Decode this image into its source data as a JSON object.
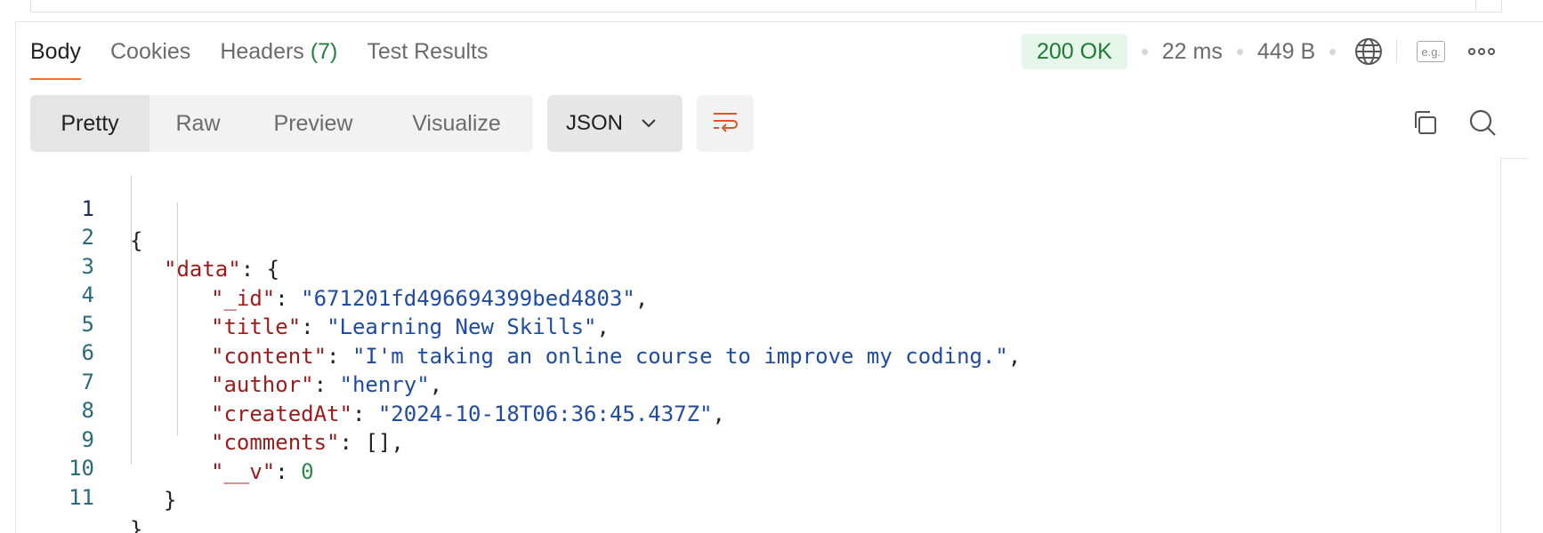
{
  "response_tabs": [
    {
      "label": "Body",
      "active": true
    },
    {
      "label": "Cookies",
      "active": false
    },
    {
      "label": "Headers",
      "count": "(7)",
      "active": false
    },
    {
      "label": "Test Results",
      "active": false
    }
  ],
  "status": {
    "code_text": "200 OK",
    "time": "22 ms",
    "size": "449 B",
    "icons": [
      "globe-icon",
      "example-icon",
      "more-icon"
    ],
    "example_label": "e.g."
  },
  "toolbar": {
    "views": [
      "Pretty",
      "Raw",
      "Preview",
      "Visualize"
    ],
    "active_view": "Pretty",
    "format": "JSON",
    "icons": [
      "chevron-down-icon",
      "wrap-lines-icon",
      "copy-icon",
      "search-icon"
    ]
  },
  "code": {
    "line_numbers": [
      "1",
      "2",
      "3",
      "4",
      "5",
      "6",
      "7",
      "8",
      "9",
      "10",
      "11"
    ],
    "lines": {
      "l1": {
        "punct": "{"
      },
      "l2": {
        "key": "\"data\"",
        "punct": ": {"
      },
      "l3": {
        "key": "\"_id\"",
        "sep": ": ",
        "value": "\"671201fd496694399bed4803\"",
        "end": ","
      },
      "l4": {
        "key": "\"title\"",
        "sep": ": ",
        "value": "\"Learning New Skills\"",
        "end": ","
      },
      "l5": {
        "key": "\"content\"",
        "sep": ": ",
        "value": "\"I'm taking an online course to improve my coding.\"",
        "end": ","
      },
      "l6": {
        "key": "\"author\"",
        "sep": ": ",
        "value": "\"henry\"",
        "end": ","
      },
      "l7": {
        "key": "\"createdAt\"",
        "sep": ": ",
        "value": "\"2024-10-18T06:36:45.437Z\"",
        "end": ","
      },
      "l8": {
        "key": "\"comments\"",
        "sep": ": ",
        "value": "[]",
        "end": ","
      },
      "l9": {
        "key": "\"__v\"",
        "sep": ": ",
        "value": "0"
      },
      "l10": {
        "punct": "}"
      },
      "l11": {
        "punct": "}"
      }
    }
  },
  "colors": {
    "accent": "#ff6c37",
    "status_green": "#1e7b34",
    "json_key": "#9c1b1b",
    "json_string": "#1f4ba0",
    "json_number": "#2b8a4a"
  }
}
